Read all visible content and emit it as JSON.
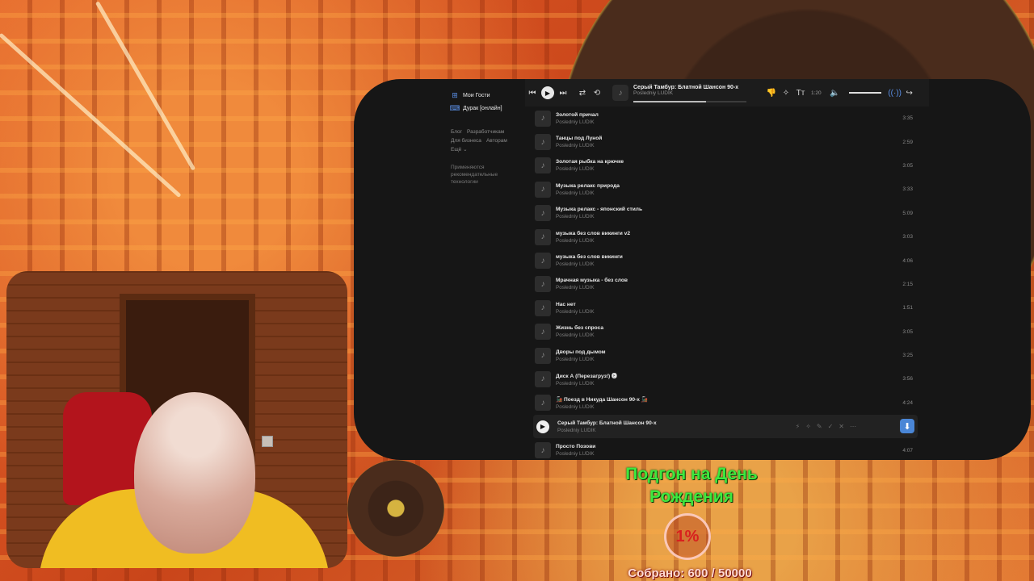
{
  "theme": {
    "accent": "#4a86d6",
    "goal_green": "#3ee83e",
    "goal_red": "#d8201e",
    "window_bg": "#161616"
  },
  "sidebar": {
    "items": [
      {
        "label": "Мои Гости",
        "icon": "grid-icon"
      },
      {
        "label": "Дурак [онлайн]",
        "icon": "gamepad-icon"
      }
    ],
    "links": [
      "Блог",
      "Разработчикам",
      "Для бизнеса",
      "Авторам",
      "Ещё ⌄"
    ],
    "note": "Применяются рекомендательные технологии"
  },
  "player": {
    "title": "Серый Тамбур: Блатной Шансон 90-х",
    "artist": "Posledniy LUDIK",
    "time": "1:20",
    "progress": 0.64,
    "volume": 0.9
  },
  "tracks": [
    {
      "title": "Золотой причал",
      "artist": "Posledniy LUDIK",
      "duration": "3:35"
    },
    {
      "title": "Танцы под Луной",
      "artist": "Posledniy LUDIK",
      "duration": "2:59"
    },
    {
      "title": "Золотая рыбка на крючке",
      "artist": "Posledniy LUDIK",
      "duration": "3:05"
    },
    {
      "title": "Музыка релакс природа",
      "artist": "Posledniy LUDIK",
      "duration": "3:33"
    },
    {
      "title": "Музыка релакс - японский стиль",
      "artist": "Posledniy LUDIK",
      "duration": "5:09"
    },
    {
      "title": "музыка без слов викинги v2",
      "artist": "Posledniy LUDIK",
      "duration": "3:03"
    },
    {
      "title": "музыка без слов викинги",
      "artist": "Posledniy LUDIK",
      "duration": "4:06"
    },
    {
      "title": "Мрачная музыка - без слов",
      "artist": "Posledniy LUDIK",
      "duration": "2:15"
    },
    {
      "title": "Нас нет",
      "artist": "Posledniy LUDIK",
      "duration": "1:51"
    },
    {
      "title": "Жизнь без спроса",
      "artist": "Posledniy LUDIK",
      "duration": "3:05"
    },
    {
      "title": "Дворы под дымом",
      "artist": "Posledniy LUDIK",
      "duration": "3:25"
    },
    {
      "title": "Диск А (Перезагруз!) 🅔",
      "artist": "Posledniy LUDIK",
      "duration": "3:56"
    },
    {
      "title": "🚂 Поезд в Никуда Шансон 90-х 🚂",
      "artist": "Posledniy LUDIK",
      "duration": "4:24"
    },
    {
      "title": "Серый Тамбур: Блатной Шансон 90-х",
      "artist": "Posledniy LUDIK",
      "duration": "",
      "active": true
    },
    {
      "title": "Просто Позови",
      "artist": "Posledniy LUDIK",
      "duration": "4:07"
    }
  ],
  "goal": {
    "title": "Подгон на День Рождения",
    "percent": "1%",
    "collected": "Собрано: 600 / 50000"
  }
}
